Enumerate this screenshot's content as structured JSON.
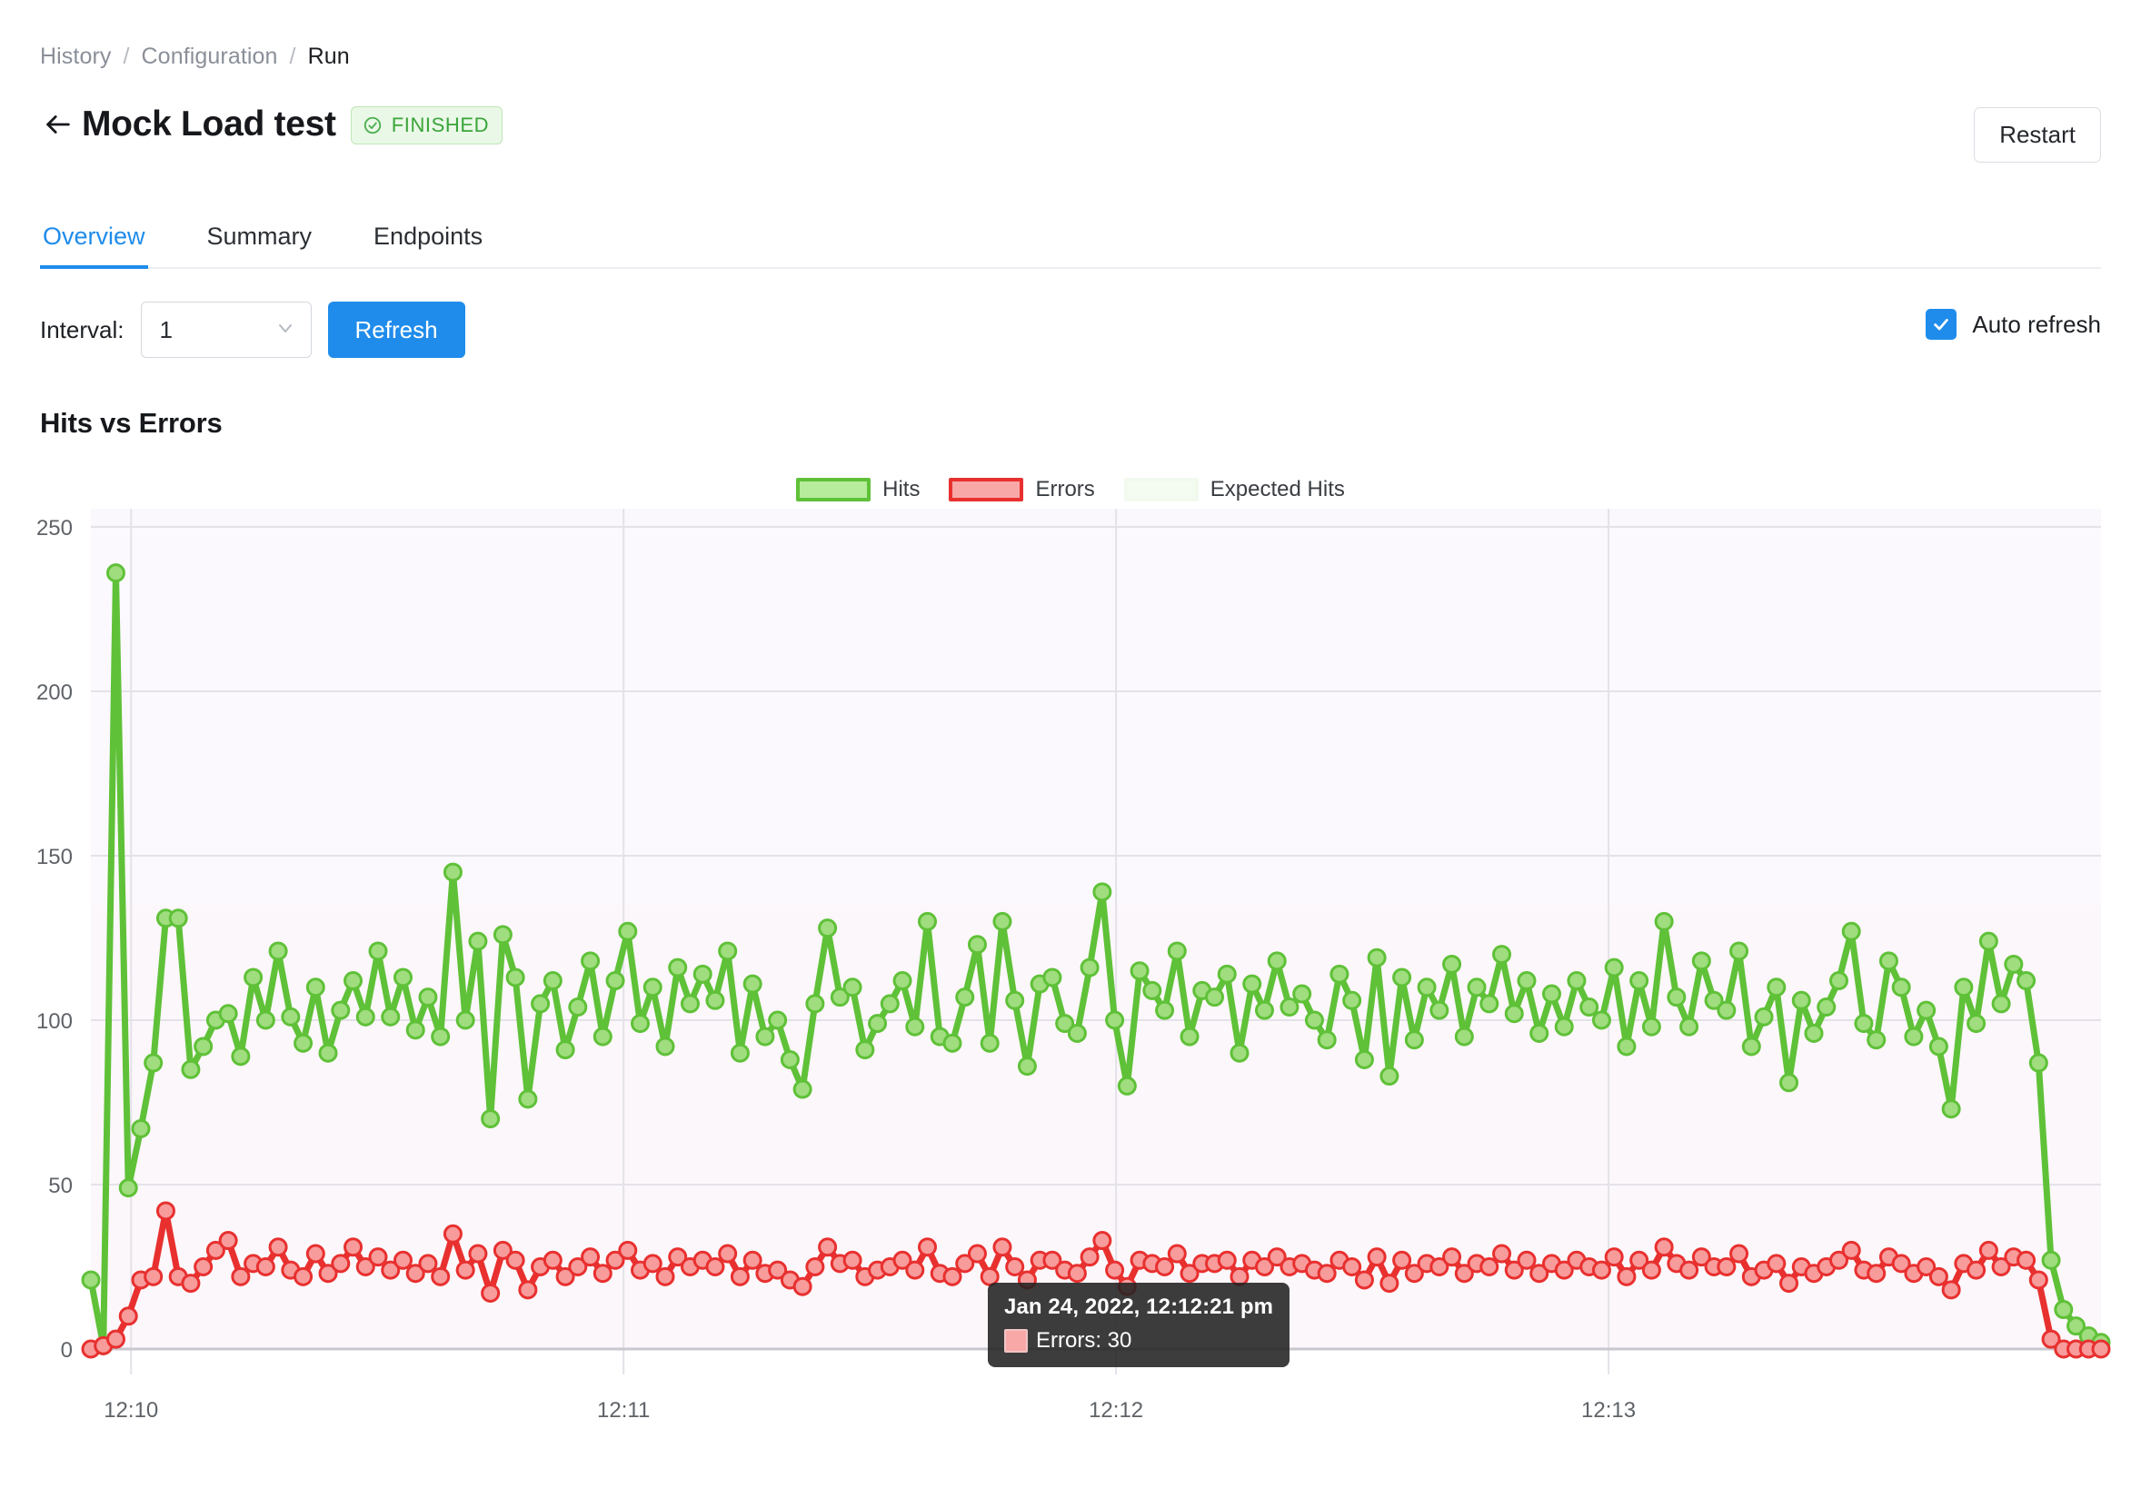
{
  "breadcrumb": {
    "items": [
      "History",
      "Configuration",
      "Run"
    ],
    "separator": "/"
  },
  "header": {
    "back_icon": "arrow-left-icon",
    "title": "Mock Load test",
    "status_badge": {
      "label": "FINISHED",
      "icon": "check-circle-icon",
      "color": "#3aa53a",
      "bg": "#eaf8e7"
    },
    "restart_label": "Restart"
  },
  "tabs": [
    {
      "label": "Overview",
      "active": true
    },
    {
      "label": "Summary",
      "active": false
    },
    {
      "label": "Endpoints",
      "active": false
    }
  ],
  "controls": {
    "interval_label": "Interval:",
    "interval_value": "1",
    "interval_options": [
      "1"
    ],
    "chevron_icon": "chevron-down-icon",
    "refresh_label": "Refresh",
    "auto_refresh_label": "Auto refresh",
    "auto_refresh_checked": true,
    "accent_color": "#1f8ceb"
  },
  "tooltip": {
    "timestamp": "Jan 24, 2022, 12:12:21 pm",
    "series_label": "Errors",
    "value": "30",
    "row_text": "Errors: 30",
    "swatch_color": "#f9a8a8"
  },
  "chart_data": {
    "type": "line",
    "title": "Hits vs Errors",
    "xlabel": "",
    "ylabel": "",
    "ylim": [
      0,
      250
    ],
    "yticks": [
      0,
      50,
      100,
      150,
      200,
      250
    ],
    "xticks": [
      "12:10",
      "12:11",
      "12:12",
      "12:13"
    ],
    "xtick_positions": [
      0.02,
      0.265,
      0.51,
      0.755
    ],
    "grid": true,
    "legend_position": "top-center",
    "legend": [
      "Hits",
      "Errors",
      "Expected Hits"
    ],
    "colors": {
      "hits": "#5fc138",
      "errors": "#e8302f",
      "expected": "#f4fbf0",
      "grid": "#e4e2e9",
      "plot_bg": "#faf8fc"
    },
    "series": [
      {
        "name": "Hits",
        "color": "#5fc138",
        "values": [
          21,
          1,
          236,
          49,
          67,
          87,
          131,
          131,
          85,
          92,
          100,
          102,
          89,
          113,
          100,
          121,
          101,
          93,
          110,
          90,
          103,
          112,
          101,
          121,
          101,
          113,
          97,
          107,
          95,
          145,
          100,
          124,
          70,
          126,
          113,
          76,
          105,
          112,
          91,
          104,
          118,
          95,
          112,
          127,
          99,
          110,
          92,
          116,
          105,
          114,
          106,
          121,
          90,
          111,
          95,
          100,
          88,
          79,
          105,
          128,
          107,
          110,
          91,
          99,
          105,
          112,
          98,
          130,
          95,
          93,
          107,
          123,
          93,
          130,
          106,
          86,
          111,
          113,
          99,
          96,
          116,
          139,
          100,
          80,
          115,
          109,
          103,
          121,
          95,
          109,
          107,
          114,
          90,
          111,
          103,
          118,
          104,
          108,
          100,
          94,
          114,
          106,
          88,
          119,
          83,
          113,
          94,
          110,
          103,
          117,
          95,
          110,
          105,
          120,
          102,
          112,
          96,
          108,
          98,
          112,
          104,
          100,
          116,
          92,
          112,
          98,
          130,
          107,
          98,
          118,
          106,
          103,
          121,
          92,
          101,
          110,
          81,
          106,
          96,
          104,
          112,
          127,
          99,
          94,
          118,
          110,
          95,
          103,
          92,
          73,
          110,
          99,
          124,
          105,
          117,
          112,
          87,
          27,
          12,
          7,
          4,
          2
        ]
      },
      {
        "name": "Errors",
        "color": "#e8302f",
        "values": [
          0,
          1,
          3,
          10,
          21,
          22,
          42,
          22,
          20,
          25,
          30,
          33,
          22,
          26,
          25,
          31,
          24,
          22,
          29,
          23,
          26,
          31,
          25,
          28,
          24,
          27,
          23,
          26,
          22,
          35,
          24,
          29,
          17,
          30,
          27,
          18,
          25,
          27,
          22,
          25,
          28,
          23,
          27,
          30,
          24,
          26,
          22,
          28,
          25,
          27,
          25,
          29,
          22,
          27,
          23,
          24,
          21,
          19,
          25,
          31,
          26,
          27,
          22,
          24,
          25,
          27,
          24,
          31,
          23,
          22,
          26,
          29,
          22,
          31,
          25,
          21,
          27,
          27,
          24,
          23,
          28,
          33,
          24,
          19,
          27,
          26,
          25,
          29,
          23,
          26,
          26,
          27,
          22,
          27,
          25,
          28,
          25,
          26,
          24,
          23,
          27,
          25,
          21,
          28,
          20,
          27,
          23,
          26,
          25,
          28,
          23,
          26,
          25,
          29,
          24,
          27,
          23,
          26,
          24,
          27,
          25,
          24,
          28,
          22,
          27,
          24,
          31,
          26,
          24,
          28,
          25,
          25,
          29,
          22,
          24,
          26,
          20,
          25,
          23,
          25,
          27,
          30,
          24,
          23,
          28,
          26,
          23,
          25,
          22,
          18,
          26,
          24,
          30,
          25,
          28,
          27,
          21,
          3,
          0,
          0,
          0,
          0
        ]
      }
    ]
  }
}
